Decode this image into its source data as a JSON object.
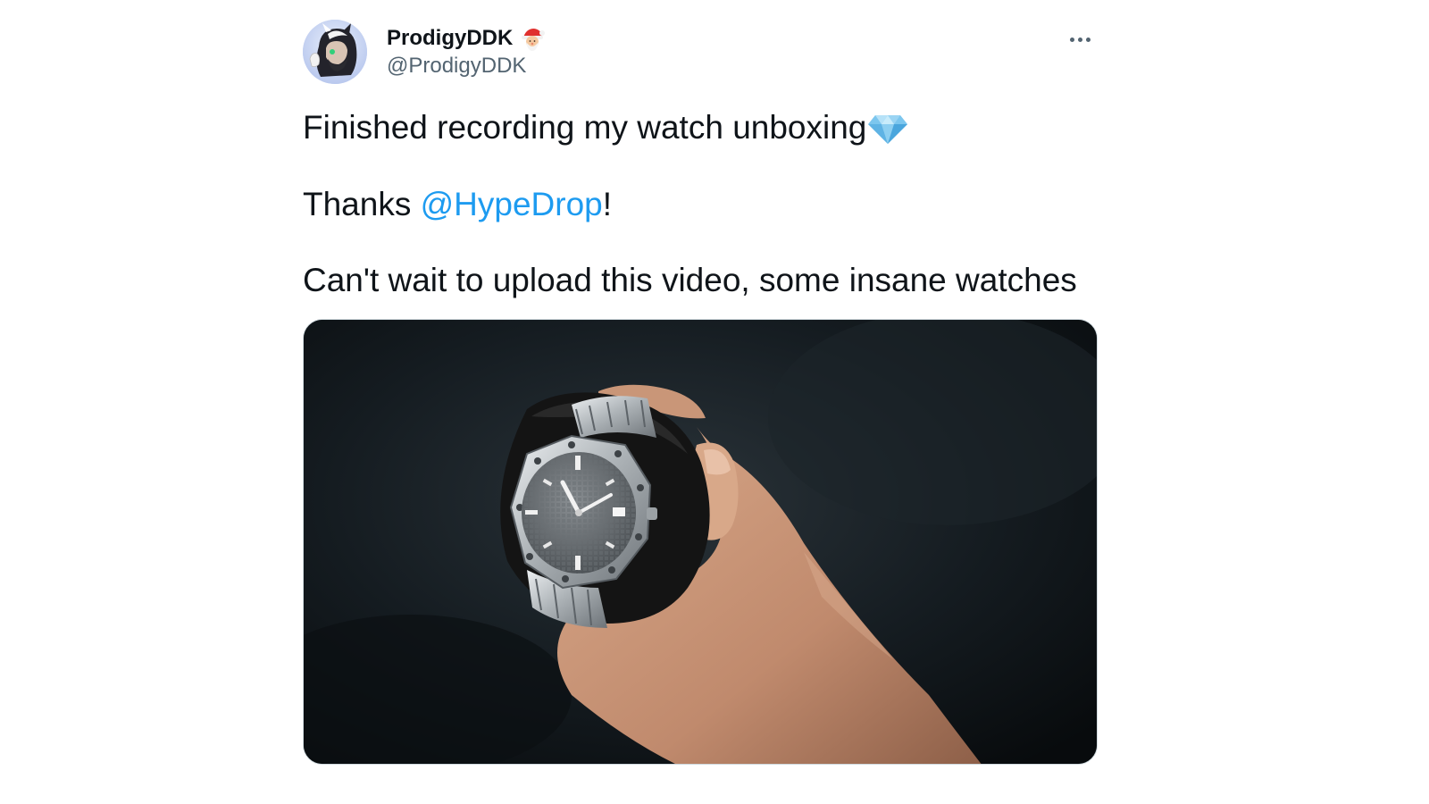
{
  "author": {
    "display_name": "ProdigyDDK",
    "handle": "@ProdigyDDK",
    "name_emoji": "santa-emoji",
    "avatar": "avatar-image"
  },
  "tweet": {
    "line1_text": "Finished recording my watch unboxing",
    "line1_emoji": "gem-emoji",
    "line2_prefix": "Thanks ",
    "line2_mention": "@HypeDrop",
    "line2_suffix": "!",
    "line3_text": "Can't wait to upload this video, some insane watches"
  },
  "media": {
    "type": "photo",
    "subject": "hand-holding-watch-image"
  },
  "icons": {
    "more": "more-options-icon"
  },
  "colors": {
    "text": "#0f1419",
    "secondary": "#536471",
    "link": "#1d9bf0",
    "border": "#cfd9de"
  }
}
